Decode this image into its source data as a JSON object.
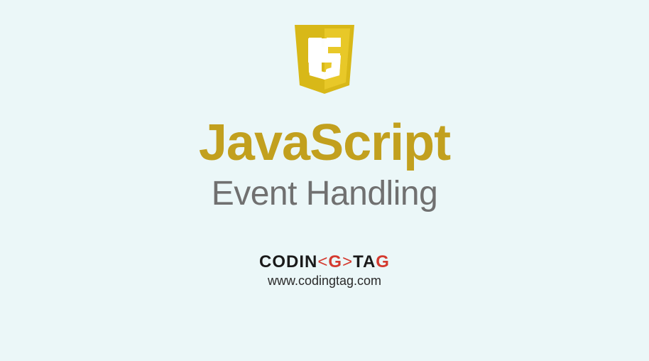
{
  "logo": {
    "text": "JS"
  },
  "title": "JavaScript",
  "subtitle": "Event Handling",
  "brand": {
    "part1": "CODIN",
    "part2": "G",
    "part3": "TA",
    "part4": "G"
  },
  "url": "www.codingtag.com"
}
